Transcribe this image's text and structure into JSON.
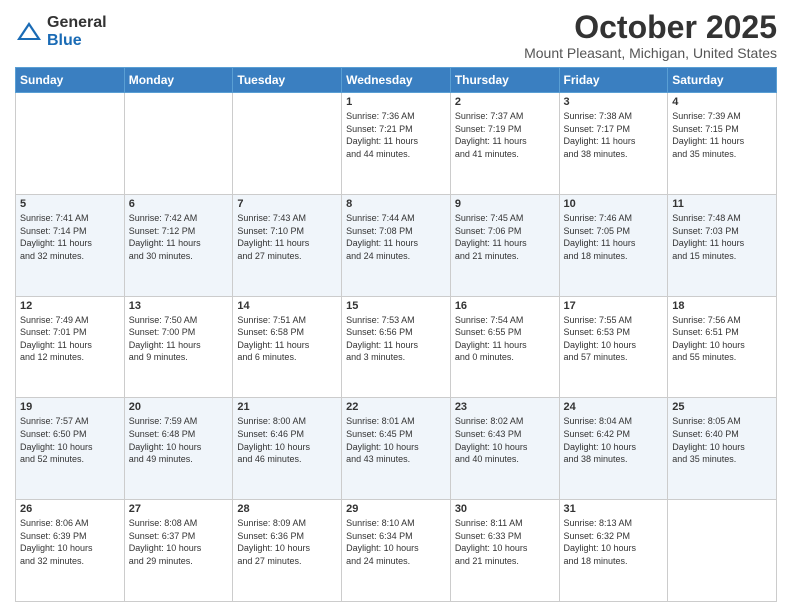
{
  "logo": {
    "general": "General",
    "blue": "Blue"
  },
  "header": {
    "month": "October 2025",
    "location": "Mount Pleasant, Michigan, United States"
  },
  "weekdays": [
    "Sunday",
    "Monday",
    "Tuesday",
    "Wednesday",
    "Thursday",
    "Friday",
    "Saturday"
  ],
  "weeks": [
    [
      {
        "day": "",
        "info": ""
      },
      {
        "day": "",
        "info": ""
      },
      {
        "day": "",
        "info": ""
      },
      {
        "day": "1",
        "info": "Sunrise: 7:36 AM\nSunset: 7:21 PM\nDaylight: 11 hours\nand 44 minutes."
      },
      {
        "day": "2",
        "info": "Sunrise: 7:37 AM\nSunset: 7:19 PM\nDaylight: 11 hours\nand 41 minutes."
      },
      {
        "day": "3",
        "info": "Sunrise: 7:38 AM\nSunset: 7:17 PM\nDaylight: 11 hours\nand 38 minutes."
      },
      {
        "day": "4",
        "info": "Sunrise: 7:39 AM\nSunset: 7:15 PM\nDaylight: 11 hours\nand 35 minutes."
      }
    ],
    [
      {
        "day": "5",
        "info": "Sunrise: 7:41 AM\nSunset: 7:14 PM\nDaylight: 11 hours\nand 32 minutes."
      },
      {
        "day": "6",
        "info": "Sunrise: 7:42 AM\nSunset: 7:12 PM\nDaylight: 11 hours\nand 30 minutes."
      },
      {
        "day": "7",
        "info": "Sunrise: 7:43 AM\nSunset: 7:10 PM\nDaylight: 11 hours\nand 27 minutes."
      },
      {
        "day": "8",
        "info": "Sunrise: 7:44 AM\nSunset: 7:08 PM\nDaylight: 11 hours\nand 24 minutes."
      },
      {
        "day": "9",
        "info": "Sunrise: 7:45 AM\nSunset: 7:06 PM\nDaylight: 11 hours\nand 21 minutes."
      },
      {
        "day": "10",
        "info": "Sunrise: 7:46 AM\nSunset: 7:05 PM\nDaylight: 11 hours\nand 18 minutes."
      },
      {
        "day": "11",
        "info": "Sunrise: 7:48 AM\nSunset: 7:03 PM\nDaylight: 11 hours\nand 15 minutes."
      }
    ],
    [
      {
        "day": "12",
        "info": "Sunrise: 7:49 AM\nSunset: 7:01 PM\nDaylight: 11 hours\nand 12 minutes."
      },
      {
        "day": "13",
        "info": "Sunrise: 7:50 AM\nSunset: 7:00 PM\nDaylight: 11 hours\nand 9 minutes."
      },
      {
        "day": "14",
        "info": "Sunrise: 7:51 AM\nSunset: 6:58 PM\nDaylight: 11 hours\nand 6 minutes."
      },
      {
        "day": "15",
        "info": "Sunrise: 7:53 AM\nSunset: 6:56 PM\nDaylight: 11 hours\nand 3 minutes."
      },
      {
        "day": "16",
        "info": "Sunrise: 7:54 AM\nSunset: 6:55 PM\nDaylight: 11 hours\nand 0 minutes."
      },
      {
        "day": "17",
        "info": "Sunrise: 7:55 AM\nSunset: 6:53 PM\nDaylight: 10 hours\nand 57 minutes."
      },
      {
        "day": "18",
        "info": "Sunrise: 7:56 AM\nSunset: 6:51 PM\nDaylight: 10 hours\nand 55 minutes."
      }
    ],
    [
      {
        "day": "19",
        "info": "Sunrise: 7:57 AM\nSunset: 6:50 PM\nDaylight: 10 hours\nand 52 minutes."
      },
      {
        "day": "20",
        "info": "Sunrise: 7:59 AM\nSunset: 6:48 PM\nDaylight: 10 hours\nand 49 minutes."
      },
      {
        "day": "21",
        "info": "Sunrise: 8:00 AM\nSunset: 6:46 PM\nDaylight: 10 hours\nand 46 minutes."
      },
      {
        "day": "22",
        "info": "Sunrise: 8:01 AM\nSunset: 6:45 PM\nDaylight: 10 hours\nand 43 minutes."
      },
      {
        "day": "23",
        "info": "Sunrise: 8:02 AM\nSunset: 6:43 PM\nDaylight: 10 hours\nand 40 minutes."
      },
      {
        "day": "24",
        "info": "Sunrise: 8:04 AM\nSunset: 6:42 PM\nDaylight: 10 hours\nand 38 minutes."
      },
      {
        "day": "25",
        "info": "Sunrise: 8:05 AM\nSunset: 6:40 PM\nDaylight: 10 hours\nand 35 minutes."
      }
    ],
    [
      {
        "day": "26",
        "info": "Sunrise: 8:06 AM\nSunset: 6:39 PM\nDaylight: 10 hours\nand 32 minutes."
      },
      {
        "day": "27",
        "info": "Sunrise: 8:08 AM\nSunset: 6:37 PM\nDaylight: 10 hours\nand 29 minutes."
      },
      {
        "day": "28",
        "info": "Sunrise: 8:09 AM\nSunset: 6:36 PM\nDaylight: 10 hours\nand 27 minutes."
      },
      {
        "day": "29",
        "info": "Sunrise: 8:10 AM\nSunset: 6:34 PM\nDaylight: 10 hours\nand 24 minutes."
      },
      {
        "day": "30",
        "info": "Sunrise: 8:11 AM\nSunset: 6:33 PM\nDaylight: 10 hours\nand 21 minutes."
      },
      {
        "day": "31",
        "info": "Sunrise: 8:13 AM\nSunset: 6:32 PM\nDaylight: 10 hours\nand 18 minutes."
      },
      {
        "day": "",
        "info": ""
      }
    ]
  ]
}
